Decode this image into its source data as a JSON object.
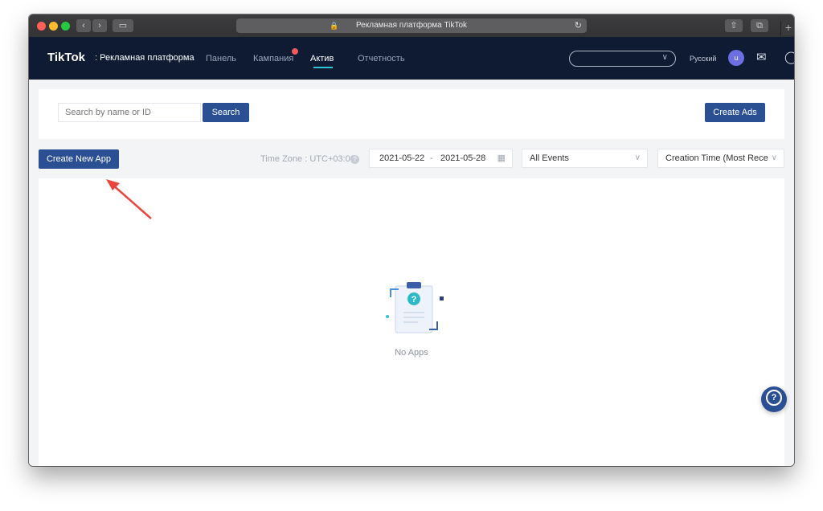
{
  "browser": {
    "tab_title": "Рекламная платформа TikTok",
    "buttons": {
      "back": "‹",
      "forward": "›",
      "sidebar": "▭"
    }
  },
  "header": {
    "logo": "TikTok",
    "logo_sub": ": Рекламная платформа",
    "nav": [
      {
        "label": "Панель"
      },
      {
        "label": "Кампания"
      },
      {
        "label": "Актив"
      },
      {
        "label": "Отчетность"
      }
    ],
    "active_nav": "Актив",
    "account_select": "",
    "language": "Русский",
    "avatar_initial": "u",
    "accent_color": "#2fc5d2"
  },
  "toolbar": {
    "search_placeholder": "Search by name or ID",
    "search_button": "Search",
    "create_ads_button": "Create Ads"
  },
  "filters": {
    "create_app_button": "Create New App",
    "timezone": "Time Zone : UTC+03:00",
    "date_start": "2021-05-22",
    "date_separator": "-",
    "date_end": "2021-05-28",
    "events": "All Events",
    "sort": "Creation Time (Most Recent)"
  },
  "empty_state": {
    "message": "No Apps"
  },
  "colors": {
    "primary": "#2b4f93",
    "header_bg": "#0e1b33",
    "arrow": "#e8453c"
  }
}
